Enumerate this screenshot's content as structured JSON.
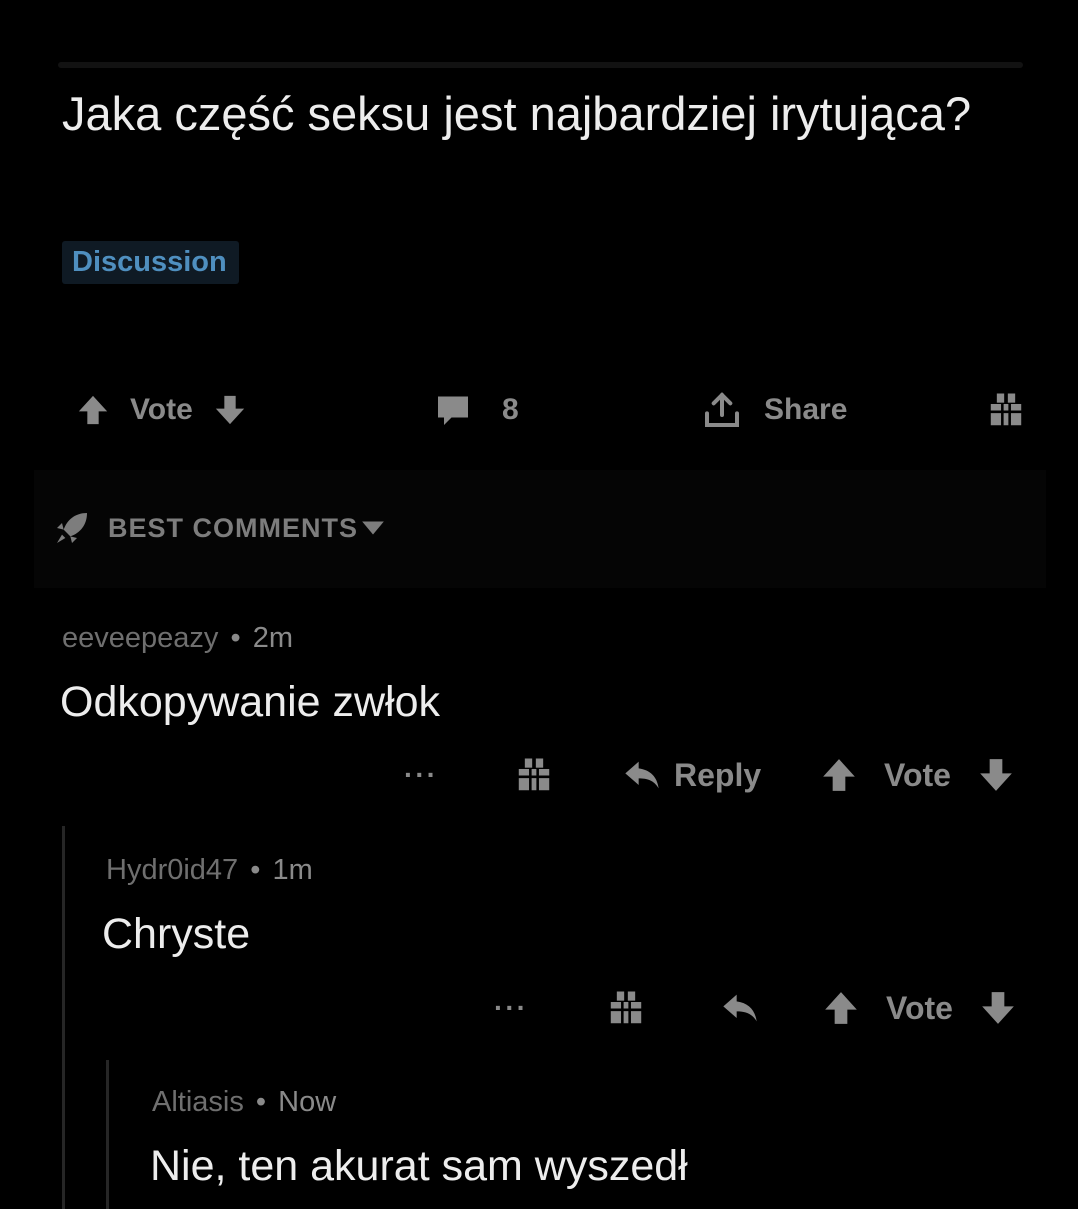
{
  "post": {
    "title": "Jaka część seksu jest najbardziej irytująca?",
    "flair": "Discussion",
    "vote_label": "Vote",
    "comment_count": "8",
    "share_label": "Share"
  },
  "sort": {
    "label": "BEST COMMENTS"
  },
  "comments": [
    {
      "author": "eeveepeazy",
      "age": "2m",
      "body": "Odkopywanie zwłok",
      "more": "···",
      "reply_label": "Reply",
      "vote_label": "Vote"
    },
    {
      "author": "Hydr0id47",
      "age": "1m",
      "body": "Chryste",
      "more": "···",
      "vote_label": "Vote"
    },
    {
      "author": "Altiasis",
      "age": "Now",
      "body": "Nie, ten akurat sam wyszedł"
    }
  ],
  "separator": "•",
  "colors": {
    "background": "#000000",
    "text": "#ededed",
    "muted": "#8a8a8a",
    "flair_text": "#4f8fbf",
    "flair_bg": "#0f1a24"
  },
  "icons": {
    "upvote": "arrow-up-icon",
    "downvote": "arrow-down-icon",
    "comments": "speech-bubble-icon",
    "share": "share-upload-icon",
    "award": "gift-icon",
    "sort": "rocket-icon",
    "reply": "reply-arrow-icon"
  }
}
